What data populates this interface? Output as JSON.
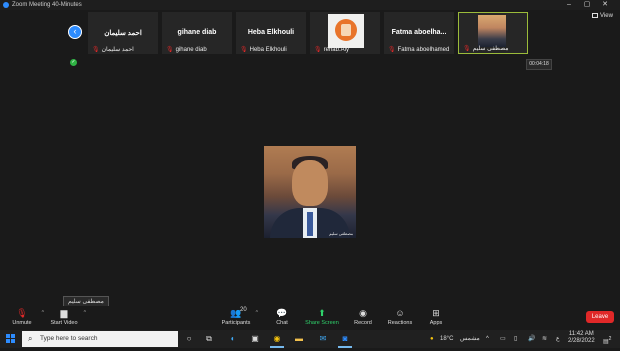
{
  "window": {
    "title": "Zoom Meeting 40-Minutes",
    "view_label": "View"
  },
  "participants_strip": [
    {
      "big_name": "احمد سليمان",
      "small_name": "احمد سليمان",
      "muted": true,
      "video": false
    },
    {
      "big_name": "gihane diab",
      "small_name": "gihane diab",
      "muted": true,
      "video": false
    },
    {
      "big_name": "Heba Elkhouli",
      "small_name": "Heba Elkhouli",
      "muted": true,
      "video": false
    },
    {
      "big_name": "",
      "small_name": "rehab.Aly",
      "muted": true,
      "video": true,
      "picture": "logo"
    },
    {
      "big_name": "Fatma  aboelha...",
      "small_name": "Fatma  aboelhamed",
      "muted": true,
      "video": false
    },
    {
      "big_name": "",
      "small_name": "مصطفى سليم",
      "muted": true,
      "video": true,
      "picture": "person",
      "active": true
    }
  ],
  "meeting_timer": "00:04:18",
  "main_video": {
    "caption": "مصطفى سليم"
  },
  "name_tooltip": "مصطفى سليم",
  "controls": {
    "unmute": "Unmute",
    "start_video": "Start Video",
    "participants": "Participants",
    "participants_count": "20",
    "chat": "Chat",
    "share_screen": "Share Screen",
    "record": "Record",
    "reactions": "Reactions",
    "apps": "Apps",
    "leave": "Leave"
  },
  "taskbar": {
    "search_placeholder": "Type here to search",
    "temperature": "18°C",
    "weather": "مشمس",
    "language": "ع",
    "time": "11:42 AM",
    "date": "2/28/2022",
    "notification_count": "2"
  },
  "colors": {
    "accent_blue": "#2d8cff",
    "leave_red": "#e02828",
    "share_green": "#2fd16b",
    "active_tile_border": "#9bbb3a"
  }
}
